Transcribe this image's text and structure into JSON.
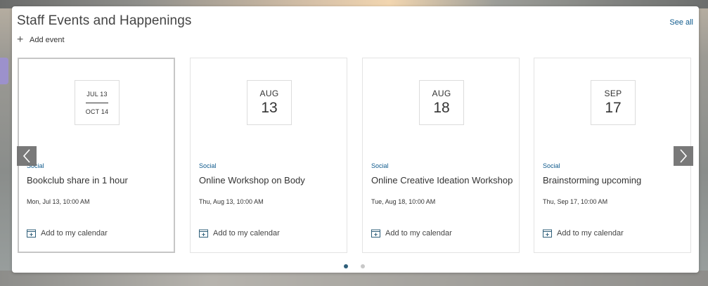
{
  "header": {
    "title": "Staff Events and Happenings",
    "see_all": "See all",
    "add_event": "Add event"
  },
  "events": [
    {
      "date_range_start": "JUL 13",
      "date_range_end": "OCT 14",
      "category": "Social",
      "title": "Bookclub share in 1 hour",
      "time": "Mon, Jul 13, 10:00 AM",
      "add_calendar": "Add to my calendar"
    },
    {
      "month": "AUG",
      "day": "13",
      "category": "Social",
      "title": "Online Workshop on Body",
      "time": "Thu, Aug 13, 10:00 AM",
      "add_calendar": "Add to my calendar"
    },
    {
      "month": "AUG",
      "day": "18",
      "category": "Social",
      "title": "Online Creative Ideation Workshop",
      "time": "Tue, Aug 18, 10:00 AM",
      "add_calendar": "Add to my calendar"
    },
    {
      "month": "SEP",
      "day": "17",
      "category": "Social",
      "title": "Brainstorming upcoming",
      "time": "Thu, Sep 17, 10:00 AM",
      "add_calendar": "Add to my calendar"
    }
  ],
  "pagination": {
    "pages": 2,
    "active": 1
  },
  "icons": {
    "add": "plus-icon",
    "calendar": "calendar-add-icon",
    "prev": "chevron-left-icon",
    "next": "chevron-right-icon"
  },
  "colors": {
    "link": "#0f5a8c",
    "active_dot": "#2f5f7a",
    "inactive_dot": "#c8c8c8",
    "arrow_bg": "#6e6e6e"
  }
}
